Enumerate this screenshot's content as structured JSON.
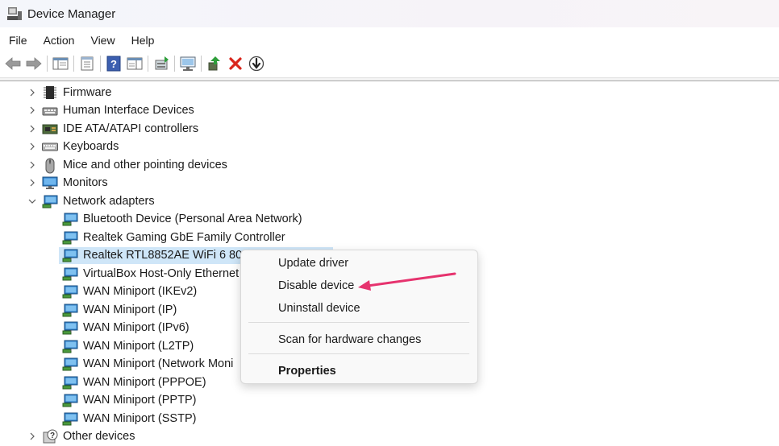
{
  "window": {
    "title": "Device Manager"
  },
  "menu": [
    "File",
    "Action",
    "View",
    "Help"
  ],
  "toolbar": {
    "buttons": [
      "back-icon",
      "forward-icon",
      "show-hide-console-tree-icon",
      "properties-sheet-icon",
      "help-icon",
      "action-pane-icon",
      "update-driver-icon",
      "scan-hardware-icon",
      "enable-device-icon",
      "uninstall-device-icon",
      "disable-device-icon"
    ]
  },
  "tree": {
    "categories": [
      {
        "label": "Firmware",
        "icon": "firmware-icon",
        "expanded": false
      },
      {
        "label": "Human Interface Devices",
        "icon": "hid-icon",
        "expanded": false
      },
      {
        "label": "IDE ATA/ATAPI controllers",
        "icon": "ide-controller-icon",
        "expanded": false
      },
      {
        "label": "Keyboards",
        "icon": "keyboard-icon",
        "expanded": false
      },
      {
        "label": "Mice and other pointing devices",
        "icon": "mouse-icon",
        "expanded": false
      },
      {
        "label": "Monitors",
        "icon": "monitor-icon",
        "expanded": false
      },
      {
        "label": "Network adapters",
        "icon": "network-adapter-icon",
        "expanded": true
      }
    ],
    "network_children": [
      "Bluetooth Device (Personal Area Network)",
      "Realtek Gaming GbE Family Controller",
      "Realtek RTL8852AE WiFi 6 802.1",
      "VirtualBox Host-Only Ethernet",
      "WAN Miniport (IKEv2)",
      "WAN Miniport (IP)",
      "WAN Miniport (IPv6)",
      "WAN Miniport (L2TP)",
      "WAN Miniport (Network Moni",
      "WAN Miniport (PPPOE)",
      "WAN Miniport (PPTP)",
      "WAN Miniport (SSTP)"
    ],
    "selected_index": 2,
    "last_category": {
      "label": "Other devices",
      "icon": "other-devices-icon",
      "expanded": false
    }
  },
  "context_menu": {
    "update_driver": "Update driver",
    "disable_device": "Disable device",
    "uninstall_device": "Uninstall device",
    "scan_hardware": "Scan for hardware changes",
    "properties": "Properties"
  },
  "colors": {
    "selection": "#cfe6f8",
    "arrow": "#e6336e",
    "uninstall_red": "#d9261c"
  }
}
